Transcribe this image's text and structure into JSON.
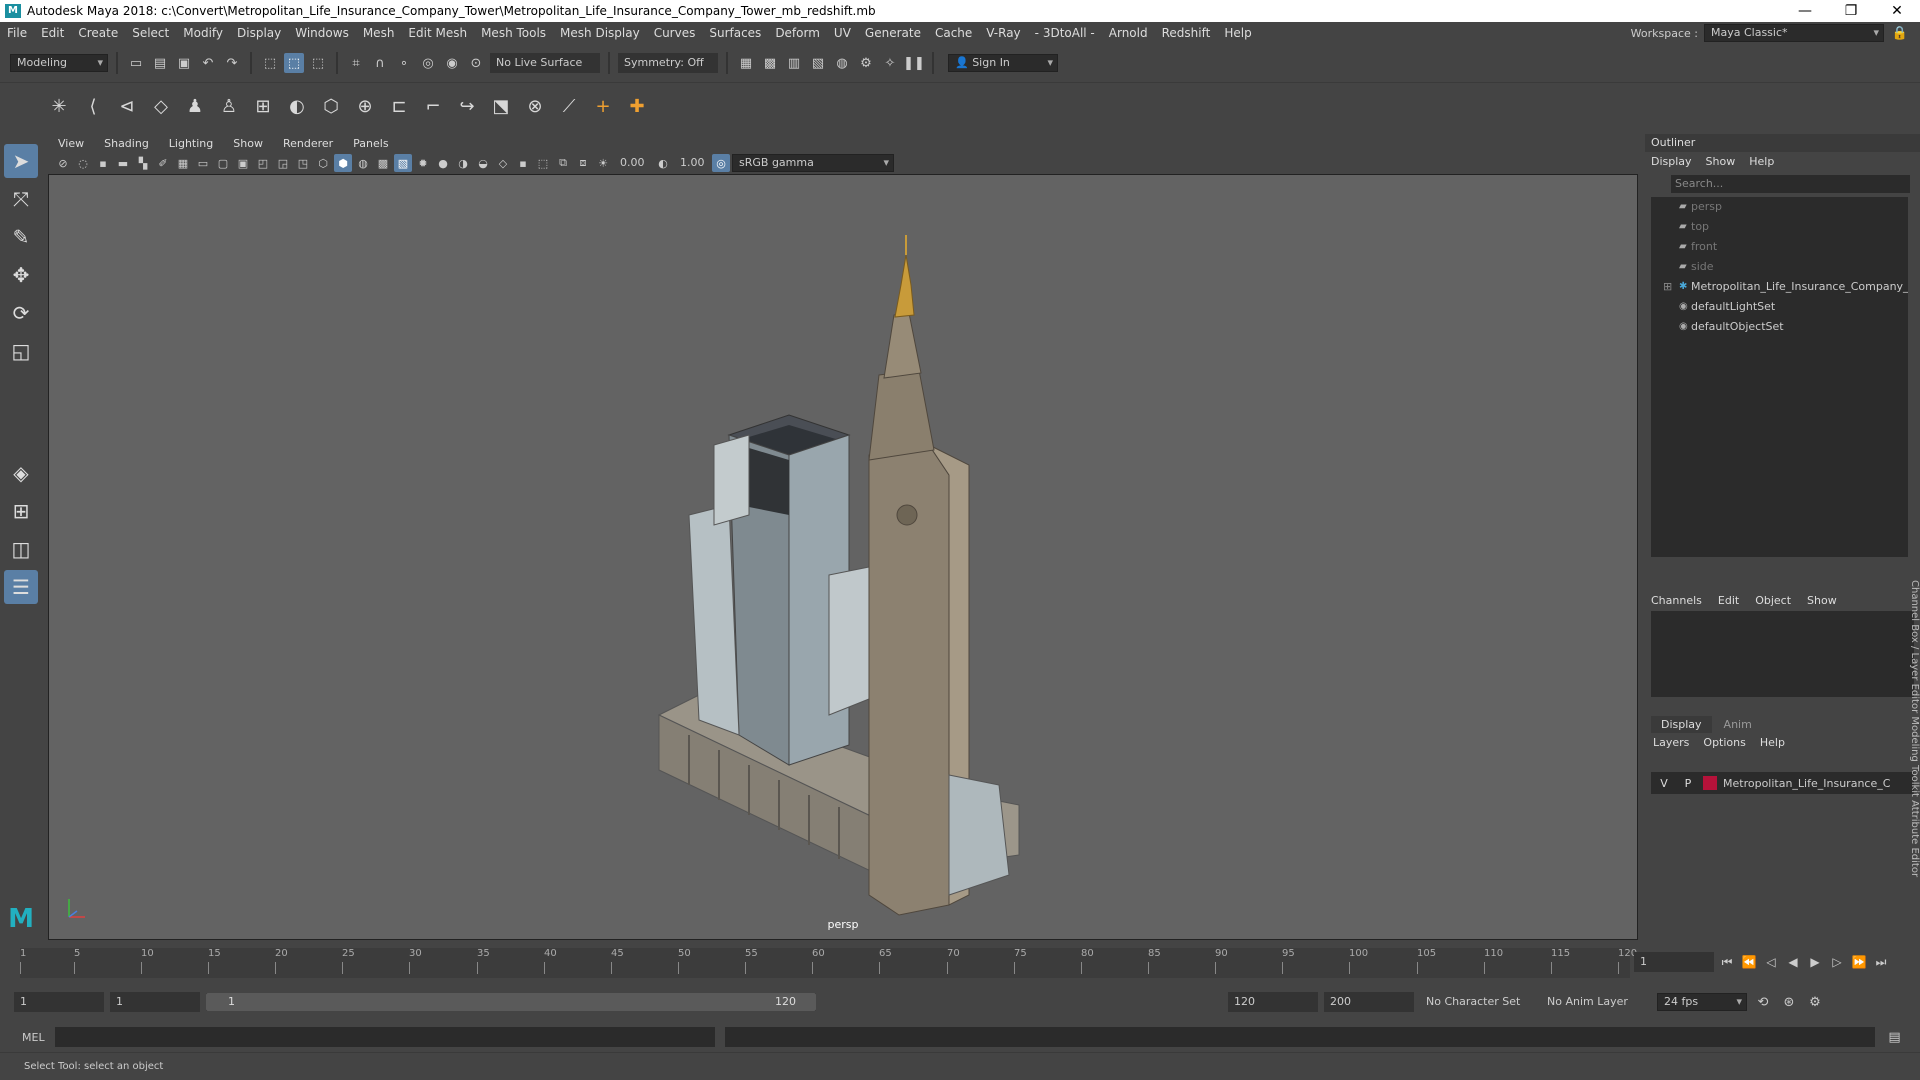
{
  "window": {
    "title": "Autodesk Maya 2018: c:\\Convert\\Metropolitan_Life_Insurance_Company_Tower\\Metropolitan_Life_Insurance_Company_Tower_mb_redshift.mb",
    "min": "—",
    "max": "❐",
    "close": "✕"
  },
  "menubar": {
    "items": [
      "File",
      "Edit",
      "Create",
      "Select",
      "Modify",
      "Display",
      "Windows",
      "Mesh",
      "Edit Mesh",
      "Mesh Tools",
      "Mesh Display",
      "Curves",
      "Surfaces",
      "Deform",
      "UV",
      "Generate",
      "Cache",
      "V-Ray",
      "- 3DtoAll -",
      "Arnold",
      "Redshift",
      "Help"
    ],
    "workspace_label": "Workspace :",
    "workspace_value": "Maya Classic*"
  },
  "statusline": {
    "mode": "Modeling",
    "live_surface": "No Live Surface",
    "symmetry": "Symmetry: Off",
    "sign_in": "Sign In"
  },
  "viewport": {
    "menus": [
      "View",
      "Shading",
      "Lighting",
      "Show",
      "Renderer",
      "Panels"
    ],
    "exposure": "0.00",
    "gamma": "1.00",
    "colorspace": "sRGB gamma",
    "camera": "persp"
  },
  "outliner": {
    "title": "Outliner",
    "menus": [
      "Display",
      "Show",
      "Help"
    ],
    "search_placeholder": "Search...",
    "items": [
      {
        "label": "persp",
        "kind": "camera"
      },
      {
        "label": "top",
        "kind": "camera"
      },
      {
        "label": "front",
        "kind": "camera"
      },
      {
        "label": "side",
        "kind": "camera"
      },
      {
        "label": "Metropolitan_Life_Insurance_Company_",
        "kind": "group"
      },
      {
        "label": "defaultLightSet",
        "kind": "set"
      },
      {
        "label": "defaultObjectSet",
        "kind": "set"
      }
    ]
  },
  "channelbox": {
    "menus": [
      "Channels",
      "Edit",
      "Object",
      "Show"
    ]
  },
  "layereditor": {
    "tabs": [
      "Display",
      "Anim"
    ],
    "menus": [
      "Layers",
      "Options",
      "Help"
    ],
    "layer": {
      "v": "V",
      "p": "P",
      "name": "Metropolitan_Life_Insurance_C",
      "color": "#b5123a"
    }
  },
  "sidetabs": "Channel Box / Layer Editor     Modeling Toolkit     Attribute Editor",
  "timeline": {
    "ticks": [
      "1",
      "5",
      "10",
      "15",
      "20",
      "25",
      "30",
      "35",
      "40",
      "45",
      "50",
      "55",
      "60",
      "65",
      "70",
      "75",
      "80",
      "85",
      "90",
      "95",
      "100",
      "105",
      "110",
      "115",
      "120"
    ],
    "current_frame": "1"
  },
  "range": {
    "start": "1",
    "playback_start": "1",
    "slider_start": "1",
    "slider_end": "120",
    "playback_end": "120",
    "end": "200",
    "character_set": "No Character Set",
    "anim_layer": "No Anim Layer",
    "fps": "24 fps"
  },
  "mel": {
    "label": "MEL"
  },
  "helpline": "Select Tool: select an object"
}
